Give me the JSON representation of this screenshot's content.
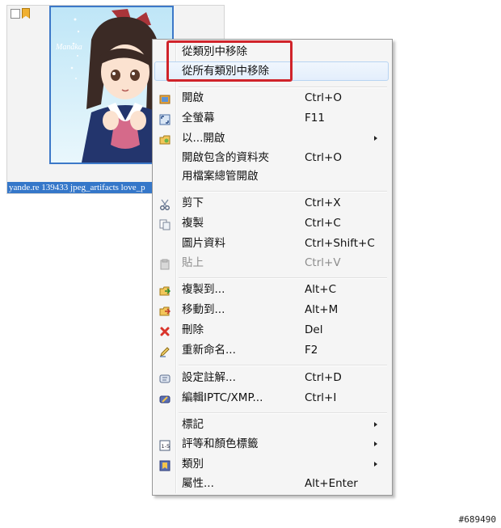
{
  "tile": {
    "caption": "yande.re 139433 jpeg_artifacts love_p",
    "thumbnail_signature": "Manaka"
  },
  "menu": {
    "items": [
      {
        "label": "從類別中移除",
        "shortcut": "",
        "icon": "",
        "submenu": false,
        "disabled": false
      },
      {
        "label": "從所有類別中移除",
        "shortcut": "",
        "icon": "",
        "submenu": false,
        "disabled": false
      },
      {
        "label": "開啟",
        "shortcut": "Ctrl+O",
        "icon": "open-image-icon",
        "submenu": false,
        "disabled": false
      },
      {
        "label": "全螢幕",
        "shortcut": "F11",
        "icon": "fullscreen-icon",
        "submenu": false,
        "disabled": false
      },
      {
        "label": "以...開啟",
        "shortcut": "",
        "icon": "open-with-icon",
        "submenu": true,
        "disabled": false
      },
      {
        "label": "開啟包含的資料夾",
        "shortcut": "Ctrl+O",
        "icon": "",
        "submenu": false,
        "disabled": false
      },
      {
        "label": "用檔案總管開啟",
        "shortcut": "",
        "icon": "",
        "submenu": false,
        "disabled": false
      },
      {
        "label": "剪下",
        "shortcut": "Ctrl+X",
        "icon": "scissors-icon",
        "submenu": false,
        "disabled": false
      },
      {
        "label": "複製",
        "shortcut": "Ctrl+C",
        "icon": "copy-icon",
        "submenu": false,
        "disabled": false
      },
      {
        "label": "圖片資料",
        "shortcut": "Ctrl+Shift+C",
        "icon": "",
        "submenu": false,
        "disabled": false
      },
      {
        "label": "貼上",
        "shortcut": "Ctrl+V",
        "icon": "paste-icon",
        "submenu": false,
        "disabled": true
      },
      {
        "label": "複製到...",
        "shortcut": "Alt+C",
        "icon": "copy-to-icon",
        "submenu": false,
        "disabled": false
      },
      {
        "label": "移動到...",
        "shortcut": "Alt+M",
        "icon": "move-to-icon",
        "submenu": false,
        "disabled": false
      },
      {
        "label": "刪除",
        "shortcut": "Del",
        "icon": "delete-icon",
        "submenu": false,
        "disabled": false
      },
      {
        "label": "重新命名...",
        "shortcut": "F2",
        "icon": "rename-icon",
        "submenu": false,
        "disabled": false
      },
      {
        "label": "設定註解...",
        "shortcut": "Ctrl+D",
        "icon": "comment-icon",
        "submenu": false,
        "disabled": false
      },
      {
        "label": "編輯IPTC/XMP...",
        "shortcut": "Ctrl+I",
        "icon": "edit-metadata-icon",
        "submenu": false,
        "disabled": false
      },
      {
        "label": "標記",
        "shortcut": "",
        "icon": "",
        "submenu": true,
        "disabled": false
      },
      {
        "label": "評等和顏色標籤",
        "shortcut": "",
        "icon": "rating-icon",
        "submenu": true,
        "disabled": false
      },
      {
        "label": "類別",
        "shortcut": "",
        "icon": "category-icon",
        "submenu": true,
        "disabled": false
      },
      {
        "label": "屬性...",
        "shortcut": "Alt+Enter",
        "icon": "",
        "submenu": false,
        "disabled": false
      }
    ]
  },
  "watermark": "#689490",
  "colors": {
    "highlight_box": "#d0232a",
    "caption_bg": "#3577c9",
    "selection_border": "#3c78c8"
  }
}
